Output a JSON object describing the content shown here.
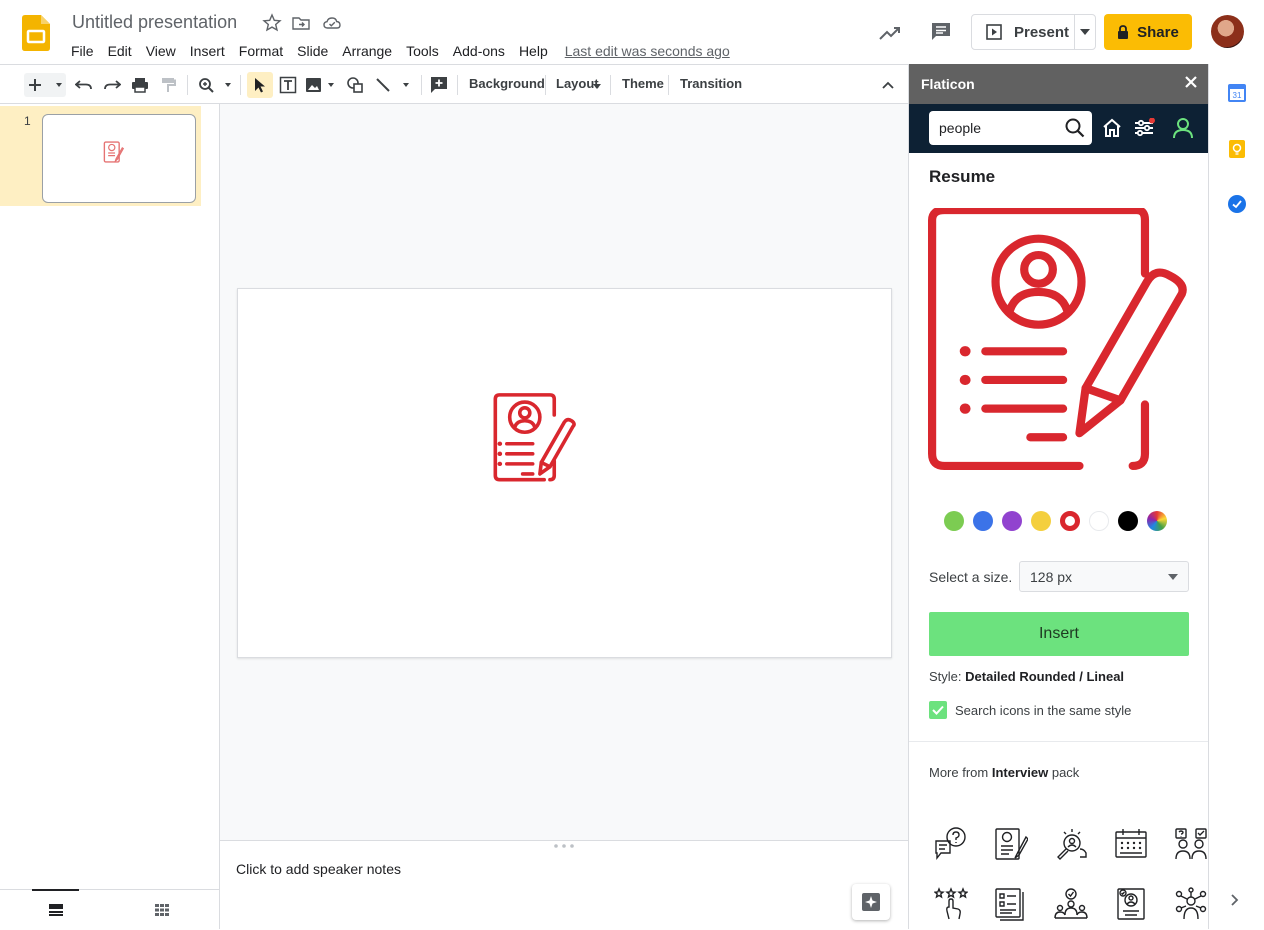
{
  "header": {
    "title": "Untitled presentation",
    "menus": [
      "File",
      "Edit",
      "View",
      "Insert",
      "Format",
      "Slide",
      "Arrange",
      "Tools",
      "Add-ons",
      "Help"
    ],
    "last_edit": "Last edit was seconds ago",
    "present_label": "Present",
    "share_label": "Share"
  },
  "toolbar": {
    "background_label": "Background",
    "layout_label": "Layout",
    "theme_label": "Theme",
    "transition_label": "Transition"
  },
  "filmstrip": {
    "slide_number": "1"
  },
  "notes": {
    "placeholder": "Click to add speaker notes"
  },
  "flaticon": {
    "panel_title": "Flaticon",
    "search_value": "people",
    "icon_title": "Resume",
    "icon_color": "#d9272e",
    "colors": [
      "#7ccc52",
      "#3b73e8",
      "#9143cf",
      "#f4cf3e",
      "#d9272e",
      "#ffffff",
      "#000000",
      "multicolor"
    ],
    "size_label": "Select a size.",
    "size_value": "128 px",
    "insert_label": "Insert",
    "style_prefix": "Style:",
    "style_value": "Detailed Rounded / Lineal",
    "same_style_label": "Search icons in the same style",
    "same_style_checked": true,
    "more_prefix": "More from",
    "pack_name": "Interview",
    "more_suffix": "pack",
    "pack_icons": [
      "question-chat-icon",
      "resume-icon",
      "search-candidate-icon",
      "calendar-icon",
      "team-question-icon",
      "rating-hand-icon",
      "documents-icon",
      "selected-candidate-icon",
      "profile-check-icon",
      "connection-people-icon"
    ]
  },
  "colors": {
    "accent_yellow": "#fbbc04",
    "insert_green": "#6ce27e",
    "flaticon_dark": "#0d2134"
  }
}
